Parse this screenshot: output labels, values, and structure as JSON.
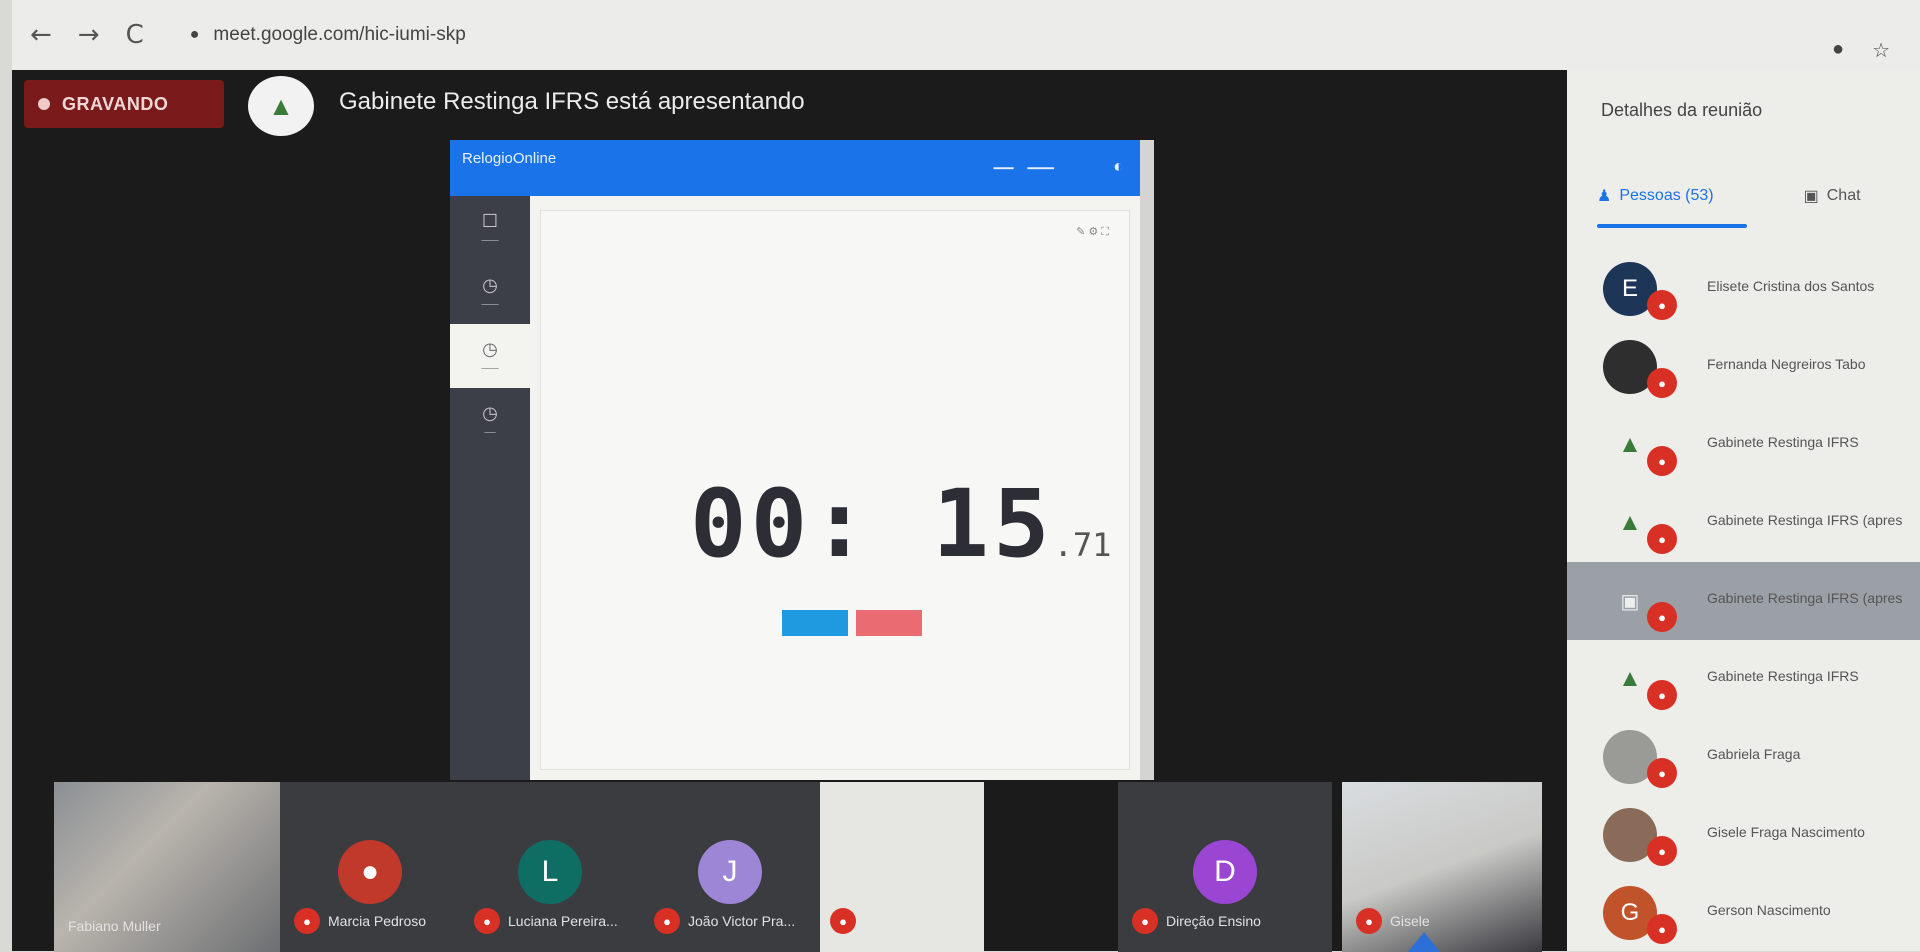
{
  "browser": {
    "back": "←",
    "forward": "→",
    "reload": "C",
    "url": "meet.google.com/hic-iumi-skp"
  },
  "meet": {
    "recording_label": "GRAVANDO",
    "presenting_text": "Gabinete Restinga IFRS está apresentando",
    "shared_screen": {
      "brand": "RelogioOnline",
      "time_main": "00: 15",
      "time_ms": ".71"
    },
    "participants": [
      {
        "name": "Fabiano Muller"
      },
      {
        "name": "Marcia Pedroso"
      },
      {
        "name": "Luciana Pereira...",
        "initial": "L"
      },
      {
        "name": "João Victor Pra...",
        "initial": "J"
      },
      {
        "name": "Direção Ensino",
        "initial": "D"
      },
      {
        "name": "Gisele"
      }
    ]
  },
  "side_panel": {
    "title": "Detalhes da reunião",
    "tab_people": "Pessoas (53)",
    "tab_chat": "Chat",
    "people": [
      {
        "name": "Elisete Cristina dos Santos",
        "initial": "E"
      },
      {
        "name": "Fernanda Negreiros Tabo"
      },
      {
        "name": "Gabinete Restinga IFRS"
      },
      {
        "name": "Gabinete Restinga IFRS (apres"
      },
      {
        "name": "Gabinete Restinga IFRS (apres"
      },
      {
        "name": "Gabinete Restinga IFRS"
      },
      {
        "name": "Gabriela Fraga"
      },
      {
        "name": "Gisele Fraga Nascimento"
      },
      {
        "name": "Gerson Nascimento",
        "initial": "G"
      }
    ]
  },
  "colors": {
    "meet_bg": "#1b1b1b",
    "recording_red": "#7a1a1a",
    "mic_red": "#d93025",
    "google_blue": "#1a73e8"
  }
}
